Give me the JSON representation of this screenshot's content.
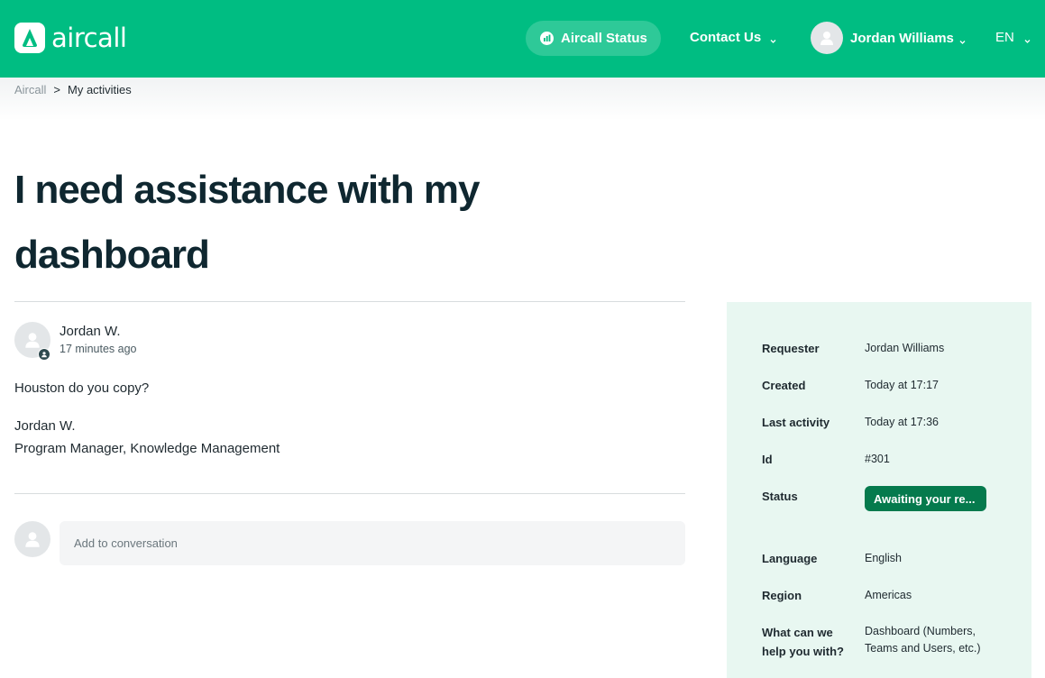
{
  "colors": {
    "brand": "#00bd82",
    "panel": "#e8f7f1",
    "status_badge": "#057a4d"
  },
  "header": {
    "logo_text": "aircall",
    "status_label": "Aircall Status",
    "contact_label": "Contact Us",
    "user_name": "Jordan Williams",
    "language": "EN"
  },
  "breadcrumb": {
    "home": "Aircall",
    "separator": ">",
    "current": "My activities"
  },
  "request": {
    "title": "I need assistance with my dashboard"
  },
  "comment": {
    "author": "Jordan W.",
    "time": "17 minutes ago",
    "body": "Houston do you copy?",
    "signature_name": "Jordan W.",
    "signature_title": "Program Manager, Knowledge Management"
  },
  "reply": {
    "placeholder": "Add to conversation"
  },
  "details": [
    {
      "label": "Requester",
      "value": "Jordan Williams"
    },
    {
      "label": "Created",
      "value": "Today at 17:17"
    },
    {
      "label": "Last activity",
      "value": "Today at 17:36"
    },
    {
      "label": "Id",
      "value": "#301"
    },
    {
      "label": "Status",
      "value": "Awaiting your re..."
    },
    {
      "label": "Language",
      "value": "English"
    },
    {
      "label": "Region",
      "value": "Americas"
    },
    {
      "label": "What can we help you with?",
      "value": "Dashboard (Numbers, Teams and Users, etc.)"
    }
  ]
}
